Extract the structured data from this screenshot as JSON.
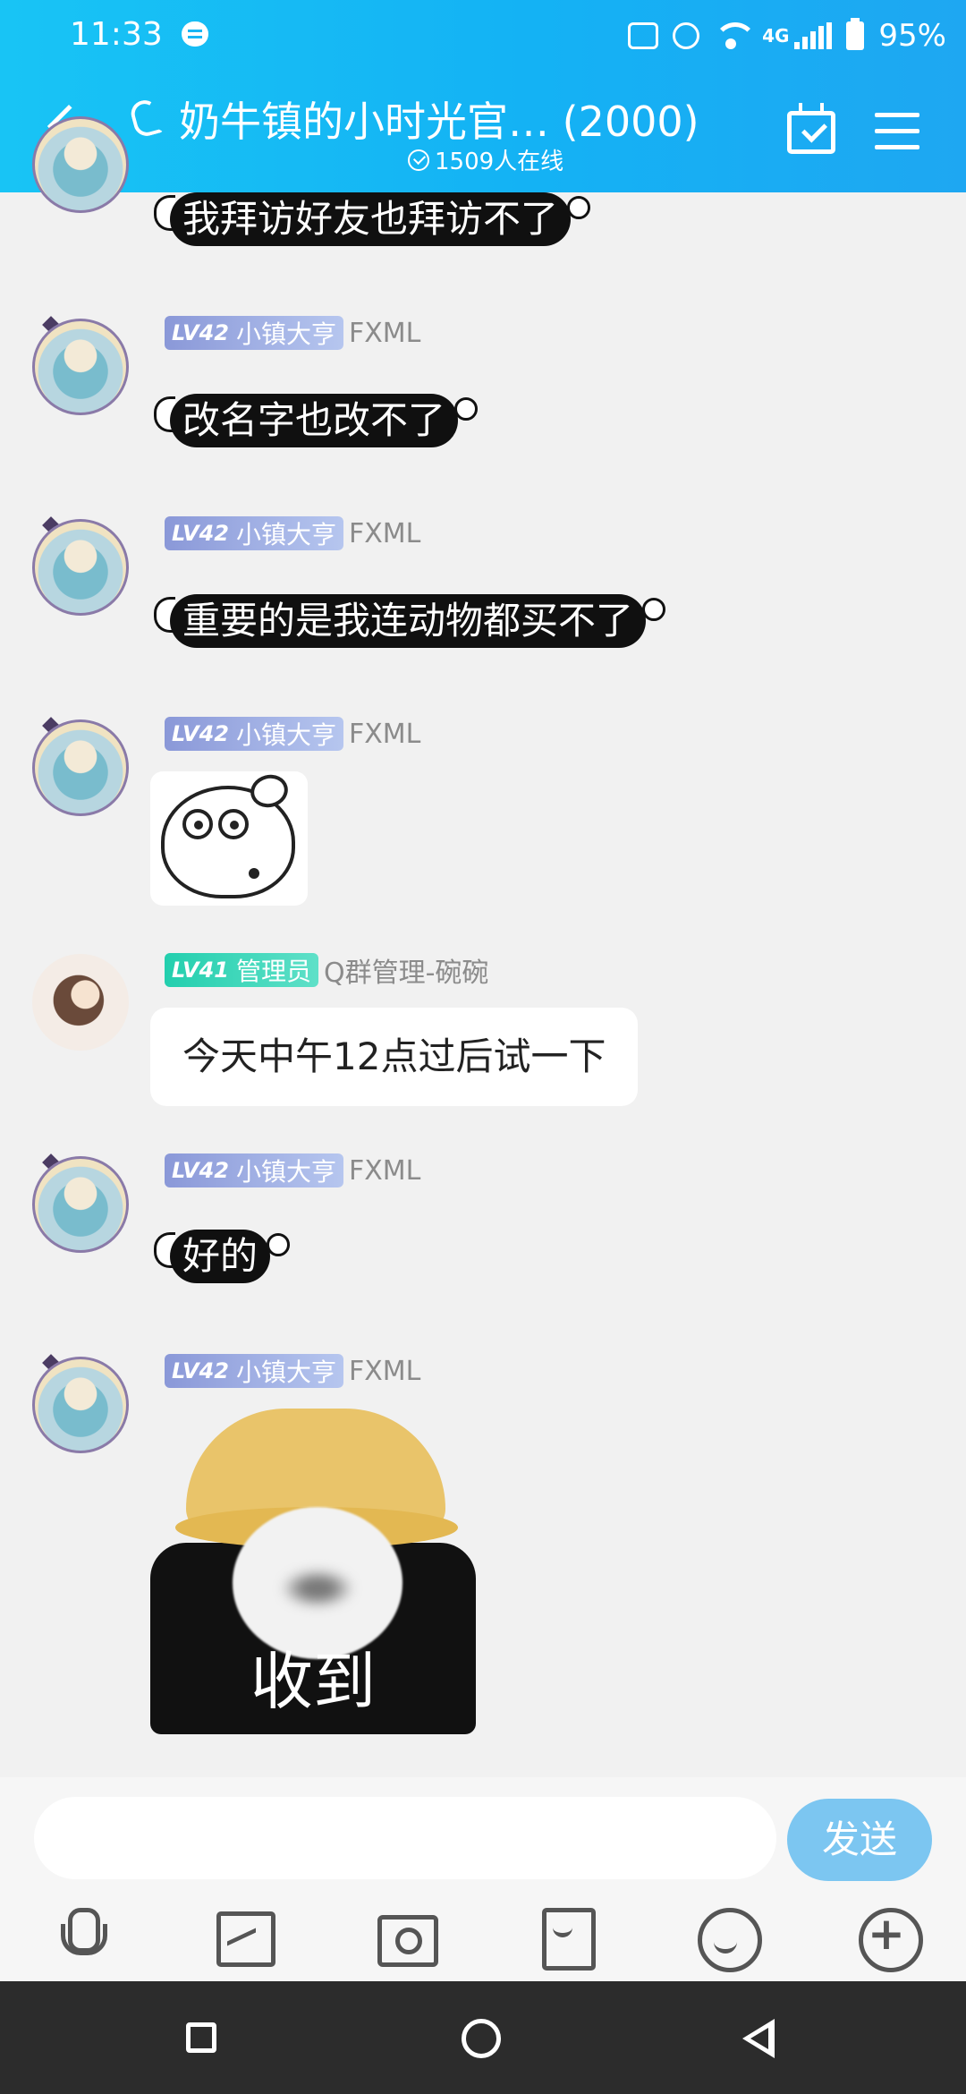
{
  "status_bar": {
    "time": "11:33",
    "network": "4G",
    "battery": "95%"
  },
  "header": {
    "title": "奶牛镇的小时光官…  (2000)",
    "online": "1509人在线"
  },
  "messages": [
    {
      "type": "fancy_text",
      "text": "我拜访好友也拜访不了"
    },
    {
      "type": "fancy_text",
      "level": "LV42",
      "title": "小镇大亨",
      "user": "FXML",
      "text": "改名字也改不了"
    },
    {
      "type": "fancy_text",
      "level": "LV42",
      "title": "小镇大亨",
      "user": "FXML",
      "text": "重要的是我连动物都买不了"
    },
    {
      "type": "sticker",
      "level": "LV42",
      "title": "小镇大亨",
      "user": "FXML"
    },
    {
      "type": "text",
      "level": "LV41",
      "title": "管理员",
      "user": "Q群管理-碗碗",
      "text": "今天中午12点过后试一下"
    },
    {
      "type": "fancy_text",
      "level": "LV42",
      "title": "小镇大亨",
      "user": "FXML",
      "text": "好的"
    },
    {
      "type": "sticker",
      "level": "LV42",
      "title": "小镇大亨",
      "user": "FXML",
      "caption": "收到"
    }
  ],
  "input_bar": {
    "send_label": "发送",
    "tools": [
      "mic-icon",
      "image-icon",
      "camera-icon",
      "red-packet-icon",
      "emoji-icon",
      "plus-icon"
    ]
  },
  "colors": {
    "header": "#14b2f4",
    "send_button": "#7cc6f1",
    "level_badge": "#8a98d8",
    "admin_badge": "#23cfae"
  }
}
